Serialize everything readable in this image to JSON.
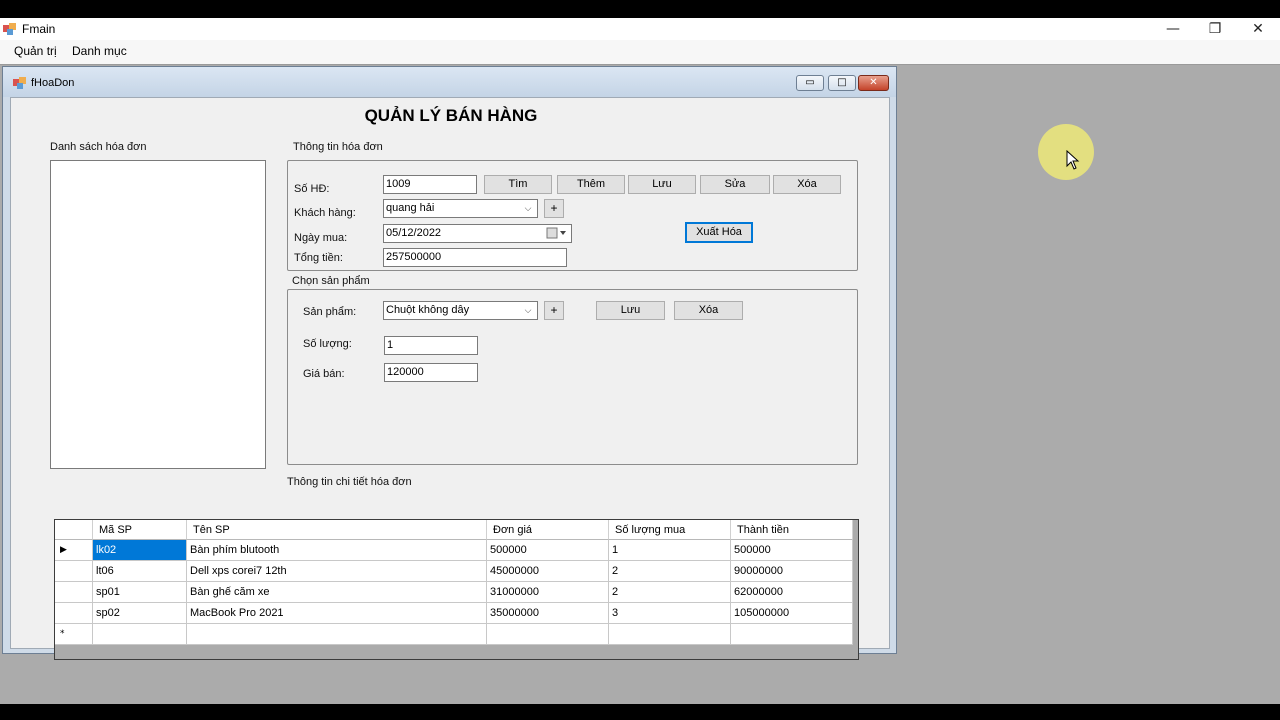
{
  "main_window": {
    "title": "Fmain",
    "controls": {
      "minimize": "—",
      "restore": "❐",
      "close": "✕"
    },
    "menu": [
      "Quản trị",
      "Danh mục"
    ]
  },
  "child_window": {
    "title": "fHoaDon",
    "controls": {
      "minimize": "▭",
      "maximize": "□",
      "close": "✕"
    },
    "heading": "QUẢN LÝ BÁN HÀNG",
    "invoice_list_label": "Danh sách hóa đơn",
    "invoice_info": {
      "group_label": "Thông tin hóa đơn",
      "so_hd_label": "Số HĐ:",
      "so_hd_value": "1009",
      "khach_hang_label": "Khách hàng:",
      "khach_hang_value": "quang hải",
      "ngay_mua_label": "Ngày mua:",
      "ngay_mua_value": "05/12/2022",
      "tong_tien_label": "Tổng tiền:",
      "tong_tien_value": "257500000",
      "buttons": {
        "tim": "Tìm",
        "them": "Thêm",
        "luu": "Lưu",
        "sua": "Sửa",
        "xoa": "Xóa",
        "xuat_hoa": "Xuất Hóa",
        "plus": "+"
      }
    },
    "product": {
      "group_label": "Chọn sản phẩm",
      "san_pham_label": "Sản phẩm:",
      "san_pham_value": "Chuột không dây",
      "so_luong_label": "Số lượng:",
      "so_luong_value": "1",
      "gia_ban_label": "Giá bán:",
      "gia_ban_value": "120000",
      "buttons": {
        "luu": "Lưu",
        "xoa": "Xóa",
        "plus": "+"
      }
    },
    "details": {
      "label": "Thông tin chi tiết hóa đơn",
      "columns": [
        "Mã SP",
        "Tên SP",
        "Đơn giá",
        "Số lượng mua",
        "Thành tiền"
      ],
      "rows": [
        [
          "lk02",
          "Bàn phím blutooth",
          "500000",
          "1",
          "500000"
        ],
        [
          "lt06",
          "Dell xps corei7 12th",
          "45000000",
          "2",
          "90000000"
        ],
        [
          "sp01",
          "Bàn ghế căm xe",
          "31000000",
          "2",
          "62000000"
        ],
        [
          "sp02",
          "MacBook Pro 2021",
          "35000000",
          "3",
          "105000000"
        ]
      ],
      "current_row_marker": "▶",
      "new_row_marker": "*"
    }
  }
}
